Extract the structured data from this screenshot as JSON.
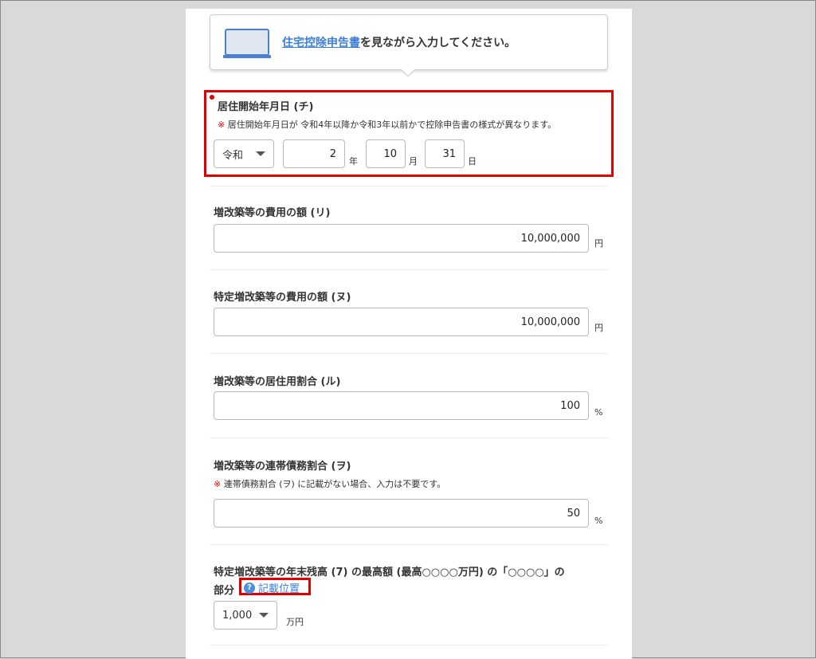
{
  "callout": {
    "link": "住宅控除申告書",
    "text": "を見ながら入力してください。"
  },
  "residence": {
    "label": "居住開始年月日 (チ)",
    "note_mark": "※",
    "note": " 居住開始年月日が 令和4年以降か令和3年以前かで控除申告書の様式が異なります。",
    "era": "令和",
    "year": "2",
    "year_unit": "年",
    "month": "10",
    "month_unit": "月",
    "day": "31",
    "day_unit": "日"
  },
  "cost": {
    "label": "増改築等の費用の額 (リ)",
    "value": "10,000,000",
    "unit": "円"
  },
  "specific_cost": {
    "label": "特定増改築等の費用の額 (ヌ)",
    "value": "10,000,000",
    "unit": "円"
  },
  "residential_ratio": {
    "label": "増改築等の居住用割合 (ル)",
    "value": "100",
    "unit": "%"
  },
  "joint_ratio": {
    "label": "増改築等の連帯債務割合 (ヲ)",
    "note_mark": "※",
    "note": " 連帯債務割合 (ヲ) に記載がない場合、入力は不要です。",
    "value": "50",
    "unit": "%"
  },
  "max_balance": {
    "label": "特定増改築等の年末残高 (7) の最高額 (最高○○○○万円) の「○○○○」の",
    "label2": "部分",
    "help_icon": "?",
    "help": "記載位置",
    "value": "1,000",
    "unit": "万円"
  }
}
